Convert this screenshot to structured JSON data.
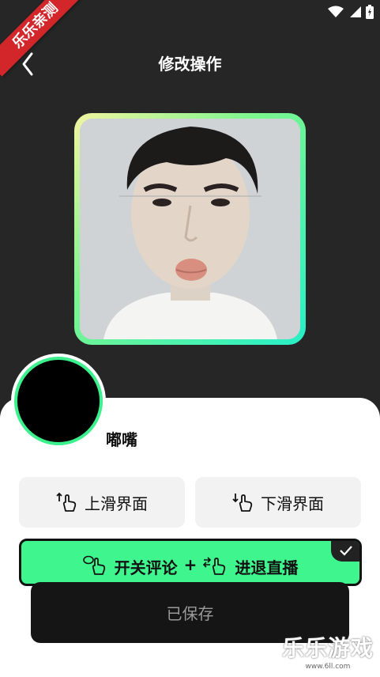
{
  "header": {
    "title": "修改操作"
  },
  "status_bar": {
    "icons": [
      "wifi-icon",
      "cellular-icon",
      "battery-icon"
    ]
  },
  "ribbon": {
    "text": "乐乐亲测"
  },
  "gesture": {
    "name": "嘟嘴"
  },
  "options": [
    {
      "label": "上滑界面",
      "icon": "swipe-up-hand-icon"
    },
    {
      "label": "下滑界面",
      "icon": "swipe-down-hand-icon"
    }
  ],
  "selected_option": {
    "left_label": "开关评论",
    "plus": "+",
    "right_label": "进退直播",
    "left_icon": "comment-hand-icon",
    "right_icon": "swap-hand-icon"
  },
  "save_button": {
    "label": "已保存"
  },
  "watermark": {
    "title": "乐乐游戏",
    "url": "www.6ll.com"
  },
  "colors": {
    "background": "#262626",
    "accent_green": "#3ef58e",
    "ribbon_red": "#d3262b",
    "save_bg": "#151515"
  }
}
